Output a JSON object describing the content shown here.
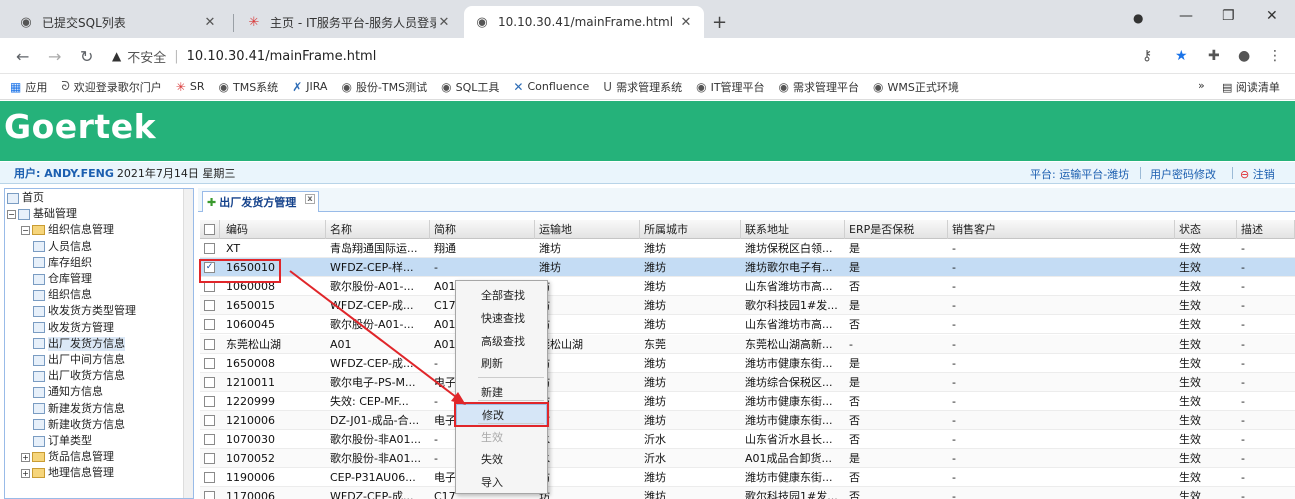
{
  "browser": {
    "tabs": [
      {
        "title": "已提交SQL列表",
        "icon": "globe-icon"
      },
      {
        "title": "主页 - IT服务平台-服务人员登录",
        "icon": "asterisk-icon"
      },
      {
        "title": "10.10.30.41/mainFrame.html",
        "icon": "globe-icon"
      }
    ],
    "address": {
      "warning": "▲",
      "insecure_label": "不安全",
      "separator": "|",
      "url": "10.10.30.41/mainFrame.html"
    },
    "bookmarks": [
      {
        "label": "应用",
        "icon": "apps-icon"
      },
      {
        "label": "欢迎登录歌尔门户",
        "icon": "g-icon"
      },
      {
        "label": "SR",
        "icon": "asterisk-icon"
      },
      {
        "label": "TMS系统",
        "icon": "globe-icon"
      },
      {
        "label": "JIRA",
        "icon": "jira-icon"
      },
      {
        "label": "股份-TMS测试",
        "icon": "globe-icon"
      },
      {
        "label": "SQL工具",
        "icon": "globe-icon"
      },
      {
        "label": "Confluence",
        "icon": "confluence-icon"
      },
      {
        "label": "需求管理系统",
        "icon": "u-icon"
      },
      {
        "label": "IT管理平台",
        "icon": "globe-icon"
      },
      {
        "label": "需求管理平台",
        "icon": "globe-icon"
      },
      {
        "label": "WMS正式环境",
        "icon": "globe-icon"
      }
    ],
    "bookmarks_more": "»",
    "reading_list": "阅读清单"
  },
  "app": {
    "logo": "Goertek",
    "user_label": "用户: ANDY.FENG",
    "date": "2021年7月14日 星期三",
    "platform": "平台: 运输平台-潍坊",
    "change_password": "用户密码修改",
    "logout": "注销",
    "brand_color": "#25b27a"
  },
  "sidebar": {
    "items": [
      {
        "label": "首页",
        "level": 0,
        "kind": "page"
      },
      {
        "label": "基础管理",
        "level": 0,
        "kind": "section"
      },
      {
        "label": "组织信息管理",
        "level": 1,
        "kind": "folder"
      },
      {
        "label": "人员信息",
        "level": 2,
        "kind": "page"
      },
      {
        "label": "库存组织",
        "level": 2,
        "kind": "page"
      },
      {
        "label": "仓库管理",
        "level": 2,
        "kind": "page"
      },
      {
        "label": "组织信息",
        "level": 2,
        "kind": "page"
      },
      {
        "label": "收发货方类型管理",
        "level": 2,
        "kind": "page"
      },
      {
        "label": "收发货方管理",
        "level": 2,
        "kind": "page"
      },
      {
        "label": "出厂发货方信息",
        "level": 2,
        "kind": "page",
        "selected": true
      },
      {
        "label": "出厂中间方信息",
        "level": 2,
        "kind": "page"
      },
      {
        "label": "出厂收货方信息",
        "level": 2,
        "kind": "page"
      },
      {
        "label": "通知方信息",
        "level": 2,
        "kind": "page"
      },
      {
        "label": "新建发货方信息",
        "level": 2,
        "kind": "page"
      },
      {
        "label": "新建收货方信息",
        "level": 2,
        "kind": "page"
      },
      {
        "label": "订单类型",
        "level": 2,
        "kind": "page"
      },
      {
        "label": "货品信息管理",
        "level": 1,
        "kind": "folder"
      },
      {
        "label": "地理信息管理",
        "level": 1,
        "kind": "folder"
      }
    ]
  },
  "content_tab": {
    "label": "出厂发货方管理"
  },
  "grid": {
    "columns": [
      "编码",
      "名称",
      "简称",
      "运输地",
      "所属城市",
      "联系地址",
      "ERP是否保税",
      "销售客户",
      "状态",
      "描述"
    ],
    "rows": [
      {
        "code": "XT",
        "name": "青岛翔通国际运...",
        "short": "翔通",
        "transport": "潍坊",
        "city": "潍坊",
        "address": "潍坊保税区白领...",
        "erp": "是",
        "customer": "-",
        "status": "生效",
        "desc": "-",
        "checked": false
      },
      {
        "code": "1650010",
        "name": "WFDZ-CEP-样...",
        "short": "-",
        "transport": "潍坊",
        "city": "潍坊",
        "address": "潍坊歌尔电子有...",
        "erp": "是",
        "customer": "-",
        "status": "生效",
        "desc": "-",
        "checked": true
      },
      {
        "code": "1060008",
        "name": "歌尔股份-A01-...",
        "short": "A01",
        "transport": "坊",
        "city": "潍坊",
        "address": "山东省潍坊市高...",
        "erp": "否",
        "customer": "-",
        "status": "生效",
        "desc": "-",
        "checked": false
      },
      {
        "code": "1650015",
        "name": "WFDZ-CEP-成...",
        "short": "C17",
        "transport": "坊",
        "city": "潍坊",
        "address": "歌尔科技园1#发...",
        "erp": "是",
        "customer": "-",
        "status": "生效",
        "desc": "-",
        "checked": false
      },
      {
        "code": "1060045",
        "name": "歌尔股份-A01-...",
        "short": "A01",
        "transport": "坊",
        "city": "潍坊",
        "address": "山东省潍坊市高...",
        "erp": "否",
        "customer": "-",
        "status": "生效",
        "desc": "-",
        "checked": false
      },
      {
        "code": "东莞松山湖",
        "name": "A01",
        "short": "A01",
        "transport": "莞松山湖",
        "city": "东莞",
        "address": "东莞松山湖高新...",
        "erp": "-",
        "customer": "-",
        "status": "生效",
        "desc": "-",
        "checked": false
      },
      {
        "code": "1650008",
        "name": "WFDZ-CEP-成...",
        "short": "-",
        "transport": "坊",
        "city": "潍坊",
        "address": "潍坊市健康东街...",
        "erp": "是",
        "customer": "-",
        "status": "生效",
        "desc": "-",
        "checked": false
      },
      {
        "code": "1210011",
        "name": "歌尔电子-PS-M...",
        "short": "电子",
        "transport": "坊",
        "city": "潍坊",
        "address": "潍坊综合保税区...",
        "erp": "是",
        "customer": "-",
        "status": "生效",
        "desc": "-",
        "checked": false
      },
      {
        "code": "1220999",
        "name": "失效: CEP-MF...",
        "short": "-",
        "transport": "坊",
        "city": "潍坊",
        "address": "潍坊市健康东街...",
        "erp": "否",
        "customer": "-",
        "status": "生效",
        "desc": "-",
        "checked": false
      },
      {
        "code": "1210006",
        "name": "DZ-J01-成品-合...",
        "short": "电子",
        "transport": "坊",
        "city": "潍坊",
        "address": "潍坊市健康东街...",
        "erp": "否",
        "customer": "-",
        "status": "生效",
        "desc": "-",
        "checked": false
      },
      {
        "code": "1070030",
        "name": "歌尔股份-非A01...",
        "short": "-",
        "transport": "水",
        "city": "沂水",
        "address": "山东省沂水县长...",
        "erp": "否",
        "customer": "-",
        "status": "生效",
        "desc": "-",
        "checked": false
      },
      {
        "code": "1070052",
        "name": "歌尔股份-非A01...",
        "short": "-",
        "transport": "水",
        "city": "沂水",
        "address": "A01成品合卸货...",
        "erp": "是",
        "customer": "-",
        "status": "生效",
        "desc": "-",
        "checked": false
      },
      {
        "code": "1190006",
        "name": "CEP-P31AU06...",
        "short": "电子",
        "transport": "坊",
        "city": "潍坊",
        "address": "潍坊市健康东街...",
        "erp": "否",
        "customer": "-",
        "status": "生效",
        "desc": "-",
        "checked": false
      },
      {
        "code": "1170006",
        "name": "WFDZ-CEP-成...",
        "short": "C17",
        "transport": "坊",
        "city": "潍坊",
        "address": "歌尔科技园1#发...",
        "erp": "否",
        "customer": "-",
        "status": "生效",
        "desc": "-",
        "checked": false
      }
    ]
  },
  "context_menu": {
    "items": [
      {
        "label": "全部查找",
        "disabled": false
      },
      {
        "label": "快速查找",
        "disabled": false
      },
      {
        "label": "高级查找",
        "disabled": false
      },
      {
        "label": "刷新",
        "disabled": false
      },
      {
        "label": "新建",
        "disabled": false
      },
      {
        "label": "修改",
        "disabled": false,
        "highlighted": true
      },
      {
        "label": "生效",
        "disabled": true
      },
      {
        "label": "失效",
        "disabled": false
      },
      {
        "label": "导入",
        "disabled": false
      }
    ]
  },
  "annotation_color": "#e0262a"
}
